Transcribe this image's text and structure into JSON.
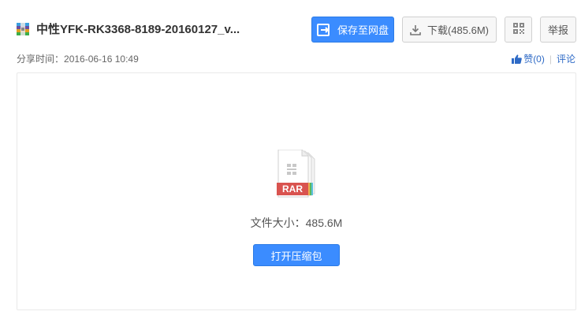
{
  "file": {
    "title": "中性YFK-RK3368-8189-20160127_v...",
    "share_time_label": "分享时间：",
    "share_time": "2016-06-16 10:49",
    "size_label": "文件大小：",
    "size": "485.6M",
    "type_label": "RAR"
  },
  "toolbar": {
    "save_label": "保存至网盘",
    "download_label": "下载(485.6M)",
    "report_label": "举报"
  },
  "actions": {
    "like_label": "赞(0)",
    "separator": "|",
    "comment_label": "评论"
  },
  "preview": {
    "open_label": "打开压缩包"
  },
  "colors": {
    "primary": "#3b8cff",
    "link": "#2e6ac6",
    "rar_red": "#d9534f"
  }
}
